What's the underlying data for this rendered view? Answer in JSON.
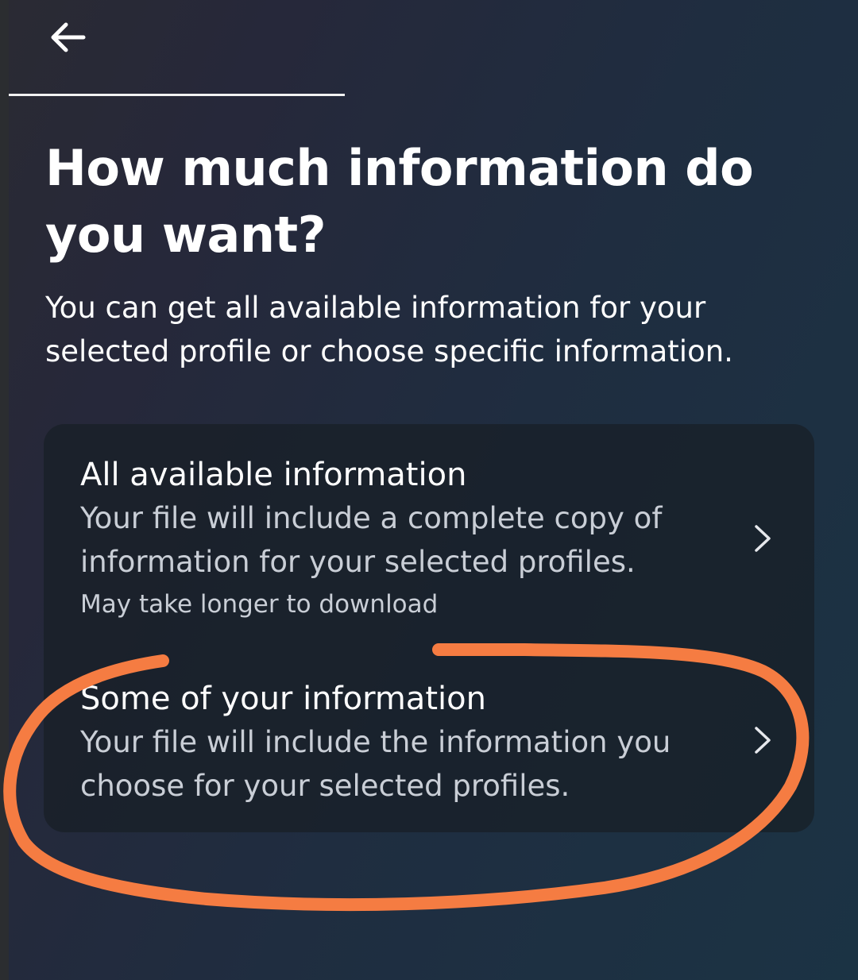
{
  "header": {
    "back_icon": "arrow-left-icon",
    "progress_fraction": 0.4
  },
  "page": {
    "title": "How much information do you want?",
    "description": "You can get all available information for your selected profile or choose specific information."
  },
  "options": [
    {
      "title": "All available information",
      "description": "Your file will include a complete copy of information for your selected profiles.",
      "note": "May take longer to download",
      "icon": "chevron-right-icon"
    },
    {
      "title": "Some of your information",
      "description": "Your file will include the information you choose for your selected profiles.",
      "icon": "chevron-right-icon"
    }
  ],
  "annotation": {
    "type": "hand-drawn circle",
    "color": "#f57c42"
  }
}
